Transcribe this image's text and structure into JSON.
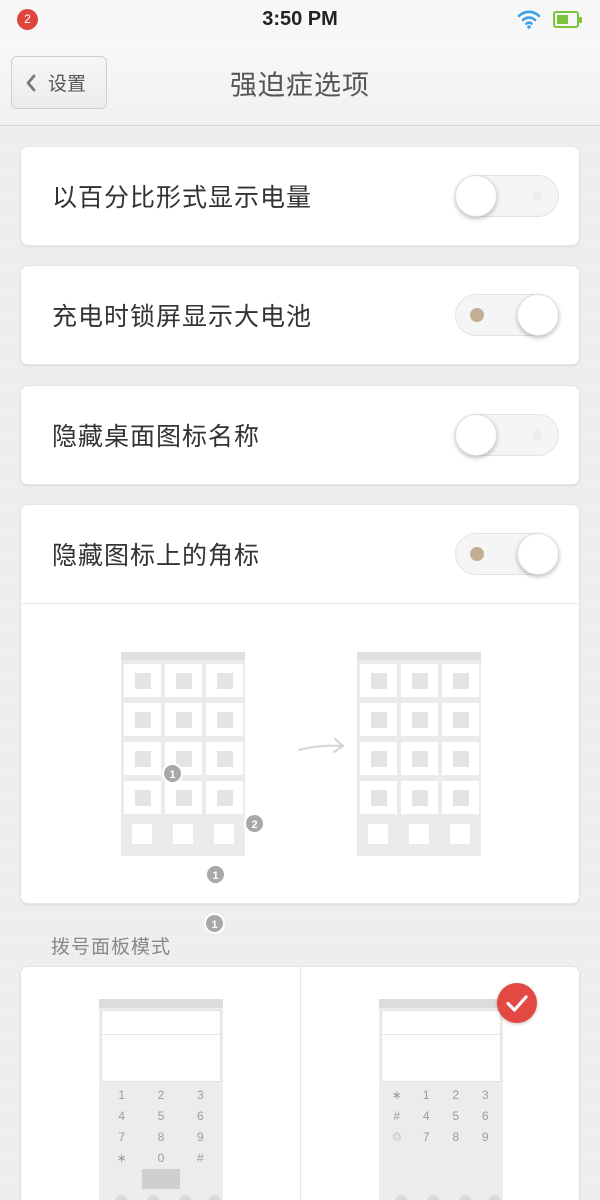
{
  "status_bar": {
    "notification_count": "2",
    "time": "3:50 PM",
    "wifi_icon": "wifi-icon",
    "battery_icon": "battery-icon",
    "battery_color": "#7cc23b"
  },
  "nav": {
    "back_label": "设置",
    "title": "强迫症选项"
  },
  "settings": [
    {
      "label": "以百分比形式显示电量",
      "enabled": false
    },
    {
      "label": "充电时锁屏显示大电池",
      "enabled": true
    },
    {
      "label": "隐藏桌面图标名称",
      "enabled": false
    },
    {
      "label": "隐藏图标上的角标",
      "enabled": true
    }
  ],
  "badge_illustration": {
    "badges": [
      "1",
      "2",
      "1",
      "1"
    ]
  },
  "dialpad": {
    "section_title": "拨号面板模式",
    "left_keys": [
      "1",
      "2",
      "3",
      "4",
      "5",
      "6",
      "7",
      "8",
      "9",
      "∗",
      "0",
      "#"
    ],
    "right_keys": [
      "∗",
      "1",
      "2",
      "3",
      "#",
      "4",
      "5",
      "6",
      "♲",
      "7",
      "8",
      "9"
    ],
    "selected": "right",
    "accent_color": "#e34842"
  }
}
